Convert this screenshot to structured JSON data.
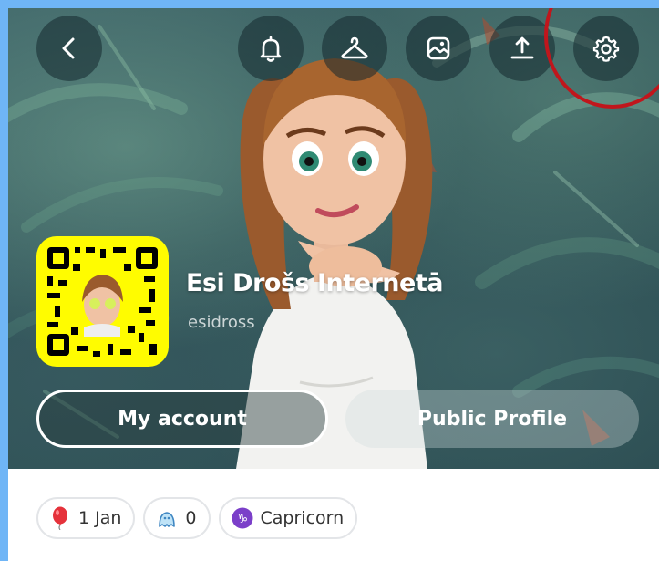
{
  "profile": {
    "display_name": "Esi Drošs Internetā",
    "username": "esidross"
  },
  "topbar": {
    "icons": [
      "back-icon",
      "bell-icon",
      "hanger-icon",
      "photo-icon",
      "share-icon",
      "gear-icon"
    ]
  },
  "buttons": {
    "my_account": "My account",
    "public_profile": "Public Profile"
  },
  "chips": [
    {
      "icon": "balloon-icon",
      "label": "1 Jan"
    },
    {
      "icon": "friends-icon",
      "label": "0"
    },
    {
      "icon": "capricorn-icon",
      "label": "Capricorn"
    }
  ],
  "colors": {
    "snapcode": "#fffc00",
    "highlight_ring": "#c0161c",
    "background_blue": "#6fb5f6",
    "zodiac_purple": "#7b3fc9"
  }
}
